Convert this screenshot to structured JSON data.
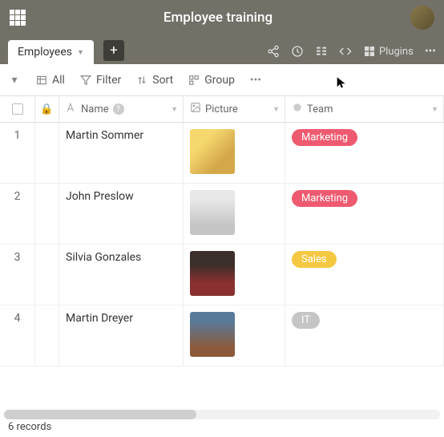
{
  "app": {
    "title": "Employee training"
  },
  "tabs": {
    "active": "Employees"
  },
  "plugins_label": "Plugins",
  "toolbar": {
    "all": "All",
    "filter": "Filter",
    "sort": "Sort",
    "group": "Group"
  },
  "columns": {
    "name": "Name",
    "picture": "Picture",
    "team": "Team"
  },
  "rows": [
    {
      "index": "1",
      "name": "Martin Sommer",
      "team": "Marketing",
      "team_class": "tag-marketing",
      "photo_class": "ph1"
    },
    {
      "index": "2",
      "name": "John Preslow",
      "team": "Marketing",
      "team_class": "tag-marketing",
      "photo_class": "ph2"
    },
    {
      "index": "3",
      "name": "Silvia Gonzales",
      "team": "Sales",
      "team_class": "tag-sales",
      "photo_class": "ph3"
    },
    {
      "index": "4",
      "name": "Martin Dreyer",
      "team": "IT",
      "team_class": "tag-it",
      "photo_class": "ph4"
    }
  ],
  "footer": {
    "record_count": "6 records"
  }
}
